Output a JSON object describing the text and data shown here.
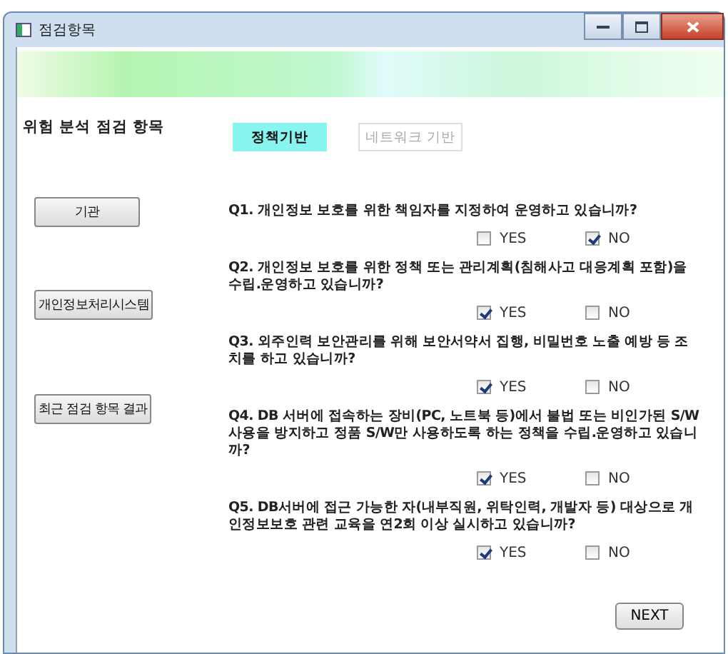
{
  "window": {
    "title": "점검항목"
  },
  "heading": "위험 분석 점검 항목",
  "tabs": [
    {
      "label": "정책기반",
      "selected": true
    },
    {
      "label": "네트워크 기반",
      "selected": false
    }
  ],
  "sidebar": {
    "buttons": [
      "기관",
      "개인정보처리시스템",
      "최근 점검 항목 결과"
    ]
  },
  "questions": [
    {
      "text": "Q1. 개인정보 보호를 위한 책임자를 지정하여 운영하고 있습니까?",
      "options": [
        {
          "label": "YES",
          "checked": false
        },
        {
          "label": "NO",
          "checked": true
        }
      ]
    },
    {
      "text": "Q2. 개인정보 보호를 위한 정책 또는 관리계획(침해사고 대응계획 포함)을 수립.운영하고 있습니까?",
      "options": [
        {
          "label": "YES",
          "checked": true
        },
        {
          "label": "NO",
          "checked": false
        }
      ]
    },
    {
      "text": "Q3. 외주인력 보안관리를 위해 보안서약서 집행, 비밀번호 노출 예방 등 조치를 하고 있습니까?",
      "options": [
        {
          "label": "YES",
          "checked": true
        },
        {
          "label": "NO",
          "checked": false
        }
      ]
    },
    {
      "text": "Q4. DB 서버에 접속하는 장비(PC, 노트북 등)에서 불법 또는 비인가된 S/W 사용을 방지하고 정품 S/W만 사용하도록 하는 정책을 수립.운영하고 있습니까?",
      "options": [
        {
          "label": "YES",
          "checked": true
        },
        {
          "label": "NO",
          "checked": false
        }
      ]
    },
    {
      "text": "Q5. DB서버에 접근 가능한 자(내부직원, 위탁인력, 개발자 등) 대상으로 개인정보보호 관련 교육을 연2회 이상 실시하고 있습니까?",
      "options": [
        {
          "label": "YES",
          "checked": true
        },
        {
          "label": "NO",
          "checked": false
        }
      ]
    }
  ],
  "next_button": "NEXT"
}
